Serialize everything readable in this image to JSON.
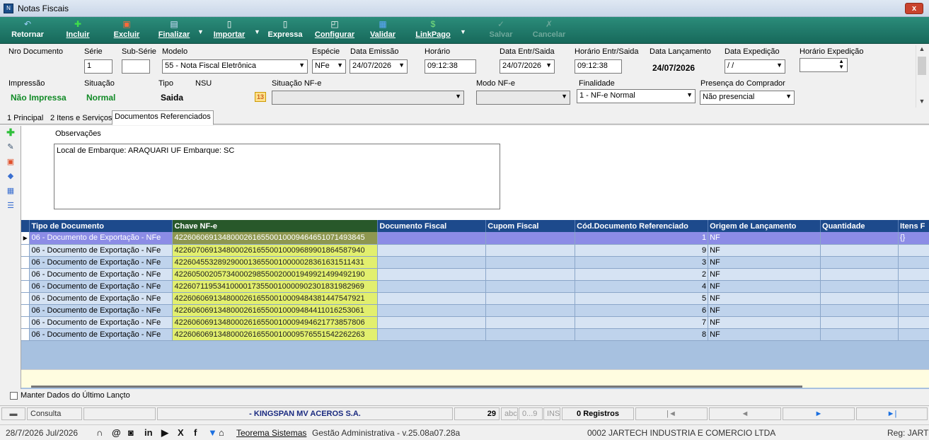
{
  "window": {
    "title": "Notas Fiscais",
    "close_glyph": "x"
  },
  "toolbar": {
    "retornar": "Retornar",
    "incluir": "Incluir",
    "excluir": "Excluir",
    "finalizar": "Finalizar",
    "importar": "Importar",
    "expressa": "Expressa",
    "configurar": "Configurar",
    "validar": "Validar",
    "linkpago": "LinkPago",
    "salvar": "Salvar",
    "cancelar": "Cancelar"
  },
  "form": {
    "nro_documento_label": "Nro Documento",
    "serie_label": "Série",
    "serie_value": "1",
    "subserie_label": "Sub-Série",
    "subserie_value": "",
    "modelo_label": "Modelo",
    "modelo_value": "55 - Nota Fiscal Eletrônica",
    "especie_label": "Espécie",
    "especie_value": "NFe",
    "data_emissao_label": "Data Emissão",
    "data_emissao_value": "24/07/2026",
    "horario_label": "Horário",
    "horario_value": "09:12:38",
    "data_entr_label": "Data Entr/Saida",
    "data_entr_value": "24/07/2026",
    "horario_entr_label": "Horário Entr/Saida",
    "horario_entr_value": "09:12:38",
    "data_lanc_label": "Data Lançamento",
    "data_lanc_value": "24/07/2026",
    "data_exp_label": "Data Expedição",
    "data_exp_value": " / /",
    "horario_exp_label": "Horário Expedição",
    "horario_exp_value": "",
    "impressao_label": "Impressão",
    "impressao_value": "Não Impressa",
    "situacao_label": "Situação",
    "situacao_value": "Normal",
    "tipo_label": "Tipo",
    "tipo_value": "Saida",
    "nsu_label": "NSU",
    "situacao_nfe_label": "Situação NF-e",
    "situacao_nfe_value": "",
    "modo_nfe_label": "Modo NF-e",
    "modo_nfe_value": "",
    "finalidade_label": "Finalidade",
    "finalidade_value": "1 - NF-e Normal",
    "presenca_label": "Presença do Comprador",
    "presenca_value": "Não presencial"
  },
  "tabs": [
    {
      "label": "1 Principal"
    },
    {
      "label": "2 Itens e Serviços"
    },
    {
      "label": "Documentos Referenciados"
    }
  ],
  "observacoes": {
    "label": "Observações",
    "text": "Local de Embarque: ARAQUARI UF Embarque: SC"
  },
  "grid": {
    "columns": [
      "Tipo de Documento",
      "Chave NF-e",
      "Documento Fiscal",
      "Cupom Fiscal",
      "Cód.Documento Referenciado",
      "Origem de Lançamento",
      "Quantidade",
      "Itens F"
    ],
    "rows": [
      {
        "tipo": "06 - Documento de Exportação - NFe",
        "chave": "42260606913480002616550010009464651071493845",
        "doc": "",
        "cupom": "",
        "cod": "1",
        "origem": "NF",
        "qtd": "",
        "itens": "{}"
      },
      {
        "tipo": "06 - Documento de Exportação - NFe",
        "chave": "42260706913480002616550010009689901864587940",
        "doc": "",
        "cupom": "",
        "cod": "9",
        "origem": "NF",
        "qtd": "",
        "itens": ""
      },
      {
        "tipo": "06 - Documento de Exportação - NFe",
        "chave": "42260455328929000136550010000028361631511431",
        "doc": "",
        "cupom": "",
        "cod": "3",
        "origem": "NF",
        "qtd": "",
        "itens": ""
      },
      {
        "tipo": "06 - Documento de Exportação - NFe",
        "chave": "42260500205734000298550020001949921499492190",
        "doc": "",
        "cupom": "",
        "cod": "2",
        "origem": "NF",
        "qtd": "",
        "itens": ""
      },
      {
        "tipo": "06 - Documento de Exportação - NFe",
        "chave": "42260711953410000173550010000902301831982969",
        "doc": "",
        "cupom": "",
        "cod": "4",
        "origem": "NF",
        "qtd": "",
        "itens": ""
      },
      {
        "tipo": "06 - Documento de Exportação - NFe",
        "chave": "42260606913480002616550010009484381447547921",
        "doc": "",
        "cupom": "",
        "cod": "5",
        "origem": "NF",
        "qtd": "",
        "itens": ""
      },
      {
        "tipo": "06 - Documento de Exportação - NFe",
        "chave": "42260606913480002616550010009484411016253061",
        "doc": "",
        "cupom": "",
        "cod": "6",
        "origem": "NF",
        "qtd": "",
        "itens": ""
      },
      {
        "tipo": "06 - Documento de Exportação - NFe",
        "chave": "42260606913480002616550010009494621773857806",
        "doc": "",
        "cupom": "",
        "cod": "7",
        "origem": "NF",
        "qtd": "",
        "itens": ""
      },
      {
        "tipo": "06 - Documento de Exportação - NFe",
        "chave": "42260606913480002616550010009576551542262263",
        "doc": "",
        "cupom": "",
        "cod": "8",
        "origem": "NF",
        "qtd": "",
        "itens": ""
      }
    ]
  },
  "bottom": {
    "manter_label": "Manter Dados do Último Lançto"
  },
  "statusbar": {
    "consulta": "Consulta",
    "company": "- KINGSPAN MV ACEROS S.A.",
    "count": "29",
    "abc": "abc",
    "num": "0...9",
    "ins": "INS",
    "registros": "0 Registros",
    "first": "|◄",
    "prev": "◄",
    "next": "►",
    "last": "►|"
  },
  "footer": {
    "date": "28/7/2026 Jul/2026",
    "teorema": "Teorema Sistemas",
    "version": "Gestão Administrativa - v.25.08a07.28a",
    "empresa": "0002 JARTECH INDUSTRIA E COMERCIO LTDA",
    "reg": "Reg: JARTEC"
  },
  "colors": {
    "toolbar": "#17695b",
    "grid_header": "#1d4a8c",
    "key_col": "#e2ef6e",
    "selected_row": "#8c8ce6"
  }
}
